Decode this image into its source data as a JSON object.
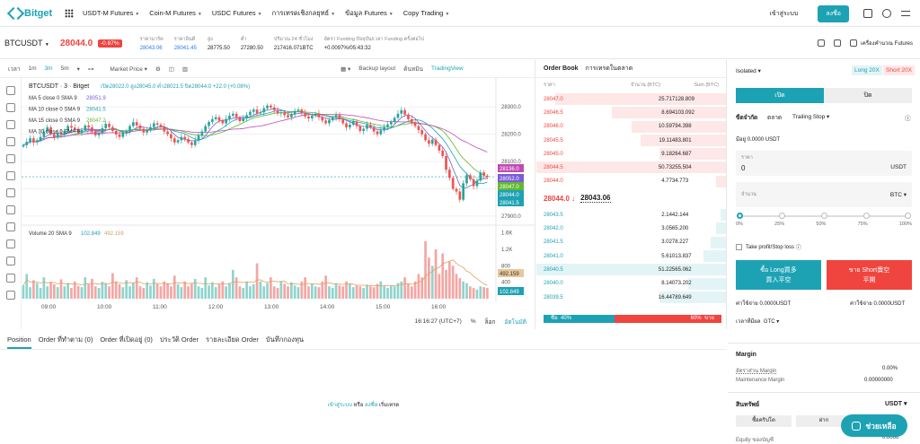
{
  "nav": {
    "logo": "Bitget",
    "items": [
      "USDT-M Futures",
      "Coin-M Futures",
      "USDC Futures",
      "การเทรดเชิงกลยุทธ์",
      "ข้อมูล Futures",
      "Copy Trading"
    ],
    "login": "เข้าสู่ระบบ",
    "signup": "ลงชื่อ"
  },
  "ticker": {
    "symbol": "BTCUSDT",
    "last_price": "28044.0",
    "change": "-0.87%",
    "stats": [
      {
        "label": "ราคามาร์ค",
        "value": "28043.06",
        "blue": true
      },
      {
        "label": "ราคาอินดี",
        "value": "28041.45",
        "blue": true
      },
      {
        "label": "สูง",
        "value": "28775.50",
        "blue": false
      },
      {
        "label": "ต่ำ",
        "value": "27280.50",
        "blue": false
      },
      {
        "label": "ปริมาณ 24 ชั่วโมง",
        "value": "217416.071BTC",
        "blue": false
      },
      {
        "label": "อัตรา Funding ปัจจุบัน/เวลา Funding ครั้งต่อไป",
        "value": "+0.0097%/05:43:32",
        "blue": false
      }
    ],
    "right_label": "เครื่องคำนวณ Futures"
  },
  "chart_toolbar": {
    "items": [
      "เวลา",
      "1m",
      "3m",
      "5m",
      "Market Price",
      "Backup layout",
      "ค้นหมิน",
      "TradingView"
    ],
    "active": "3m"
  },
  "chart_data": {
    "type": "candlestick",
    "title": "BTCUSDT · 3 · Bitget",
    "ohlc_label": "เปิด28022.0 สูง28045.0 ต่ำ28021.5 ปิด28044.0 +22.0 (+0.08%)",
    "ma_labels": [
      {
        "text": "MA 5 close 0 SMA 9",
        "value": "28051.9",
        "color": "#7b5cd6"
      },
      {
        "text": "MA 10 close 0 SMA 9",
        "value": "28041.5",
        "color": "#1da2b4"
      },
      {
        "text": "MA 15 close 0 SMA 9",
        "value": "28047.2",
        "color": "#62b82e"
      },
      {
        "text": "MA 30 close 0 SMA 9",
        "value": "28035.9",
        "color": "#c04bb4"
      }
    ],
    "y_ticks": [
      "28300.0",
      "28200.0",
      "28100.0",
      "28000.0",
      "27900.0"
    ],
    "y_range": [
      27880,
      28340
    ],
    "price_badges": [
      {
        "value": "28136.0",
        "color": "#c04bb4"
      },
      {
        "value": "28052.0",
        "color": "#7b5cd6"
      },
      {
        "value": "28047.0",
        "color": "#62b82e"
      },
      {
        "value": "28044.0",
        "color": "#1da2b4"
      },
      {
        "value": "28041.5",
        "color": "#1da2b4"
      }
    ],
    "x_ticks": [
      "09:00",
      "10:00",
      "11:00",
      "12:00",
      "13:00",
      "14:00",
      "15:00",
      "16:00"
    ],
    "close": [
      28160,
      28172,
      28185,
      28170,
      28178,
      28190,
      28210,
      28225,
      28200,
      28188,
      28205,
      28198,
      28212,
      28230,
      28224,
      28218,
      28205,
      28215,
      28232,
      28225,
      28210,
      28196,
      28205,
      28222,
      28238,
      28226,
      28212,
      28199,
      28190,
      28205,
      28210,
      28230,
      28244,
      28232,
      28220,
      28206,
      28214,
      28226,
      28240,
      28235,
      28226,
      28210,
      28200,
      28185,
      28170,
      28178,
      28190,
      28182,
      28170,
      28160,
      28178,
      28195,
      28210,
      28230,
      28245,
      28255,
      28262,
      28250,
      28240,
      28256,
      28268,
      28275,
      28262,
      28248,
      28258,
      28270,
      28282,
      28290,
      28276,
      28280,
      28295,
      28305,
      28298,
      28288,
      28276,
      28280,
      28270,
      28262,
      28272,
      28285,
      28290,
      28278,
      28265,
      28258,
      28268,
      28275,
      28262,
      28250,
      28240,
      28252,
      28262,
      28270,
      28255,
      28240,
      28225,
      28235,
      28246,
      28230,
      28212,
      28220,
      28234,
      28225,
      28210,
      28200,
      28214,
      28226,
      28236,
      28245,
      28260,
      28275,
      28288,
      28272,
      28255,
      28242,
      28230,
      28215,
      28200,
      28178,
      28165,
      28180,
      28160,
      28140,
      28120,
      28070,
      28040,
      28000,
      27990,
      27960,
      28020,
      28050,
      28035,
      28010,
      28030,
      28060,
      28048,
      28044
    ],
    "volume_label": "Volume 20 SMA 9",
    "volume_values": [
      "102.849",
      "492.159"
    ],
    "volume_ticks": [
      "1.6K",
      "1.2K",
      "800",
      "400"
    ],
    "volume": [
      320,
      600,
      280,
      450,
      380,
      260,
      520,
      300,
      410,
      350,
      280,
      470,
      300,
      380,
      260,
      420,
      310,
      280,
      520,
      350,
      480,
      300,
      260,
      410,
      380,
      300,
      620,
      420,
      350,
      280,
      450,
      300,
      380,
      520,
      300,
      260,
      400,
      320,
      480,
      360,
      300,
      420,
      380,
      300,
      560,
      350,
      280,
      420,
      300,
      360,
      480,
      300,
      260,
      520,
      320,
      400,
      280,
      350,
      420,
      300,
      380,
      700,
      520,
      300,
      260,
      420,
      300,
      350,
      860,
      420,
      300,
      380,
      520,
      300,
      260,
      420,
      360,
      300,
      400,
      320,
      280,
      420,
      520,
      300,
      360,
      300,
      280,
      420,
      560,
      300,
      260,
      380,
      320,
      300,
      420,
      360,
      280,
      320,
      300,
      260,
      340,
      300,
      280,
      360,
      420,
      300,
      260,
      320,
      300,
      380,
      420,
      520,
      360,
      300,
      420,
      600,
      520,
      1400,
      1000,
      800,
      1200,
      600,
      1100,
      700,
      900,
      800,
      600,
      500,
      420,
      380,
      300,
      260,
      220,
      300,
      280,
      260
    ],
    "time_label": "16:16:27 (UTC+7)",
    "footer": [
      "%",
      "ล็อก",
      "อัตโนมัติ"
    ]
  },
  "orderbook": {
    "tabs": [
      "Order Book",
      "การเทรดในตลาด"
    ],
    "headers": [
      "ราคา",
      "จำนวน (BTC)",
      "Sum (BTC)"
    ],
    "asks": [
      {
        "p": "28047.0",
        "a": "25.717",
        "s": "128.809",
        "w": 0.9
      },
      {
        "p": "28046.5",
        "a": "8.694",
        "s": "103.092",
        "w": 0.6
      },
      {
        "p": "28046.0",
        "a": "10.597",
        "s": "94.398",
        "w": 0.5
      },
      {
        "p": "28045.5",
        "a": "19.114",
        "s": "83.801",
        "w": 0.45
      },
      {
        "p": "28045.0",
        "a": "9.182",
        "s": "64.687",
        "w": 0.35
      },
      {
        "p": "28044.5",
        "a": "50.732",
        "s": "55.504",
        "w": 1.0
      },
      {
        "p": "28044.0",
        "a": "4.773",
        "s": "4.773",
        "w": 0.05
      }
    ],
    "mid_price": "28044.0 ↓",
    "mark_price": "28043.06",
    "bids": [
      {
        "p": "28043.5",
        "a": "2.144",
        "s": "2.144",
        "w": 0.03
      },
      {
        "p": "28042.0",
        "a": "3.056",
        "s": "5.200",
        "w": 0.05
      },
      {
        "p": "28041.5",
        "a": "3.027",
        "s": "8.227",
        "w": 0.08
      },
      {
        "p": "28041.0",
        "a": "5.610",
        "s": "13.837",
        "w": 0.12
      },
      {
        "p": "28040.5",
        "a": "51.225",
        "s": "65.062",
        "w": 1.0
      },
      {
        "p": "28040.0",
        "a": "8.140",
        "s": "73.202",
        "w": 0.2
      },
      {
        "p": "28039.5",
        "a": "16.447",
        "s": "89.649",
        "w": 0.35
      }
    ],
    "buy_label": "ซื้อ",
    "buy_pct": "40%",
    "buy_ratio": 0.4,
    "sell_pct": "60%",
    "sell_label": "ขาย"
  },
  "order_panel": {
    "margin_mode": "Isolated",
    "long_lev": "Long 20X",
    "short_lev": "Short 20X",
    "open": "เปิด",
    "close": "ปิด",
    "order_types": [
      "ขีดจำกัด",
      "ตลาด",
      "Trailing Stop"
    ],
    "available": "มีอยู่ 0.0000 USDT",
    "price_label": "ราคา",
    "price_value": "0",
    "price_unit": "USDT",
    "qty_label": "จำนวน",
    "qty_unit": "BTC",
    "slider_ticks": [
      "0%",
      "25%",
      "50%",
      "75%",
      "100%"
    ],
    "slider_level": 0,
    "tpsl": "Take profit/Stop loss",
    "long_btn": [
      "ซื้อ Long買多",
      "買入平空"
    ],
    "short_btn": [
      "ขาย Short賣空",
      "平開"
    ],
    "cost_long": "ค่าใช้จ่าย 0.0000USDT",
    "cost_short": "ค่าใช้จ่าย 0.0000USDT",
    "tif_label": "เวลาที่มีผล",
    "tif_value": "GTC",
    "margin_title": "Margin",
    "margin_ratio_label": "อัตราส่วน Margin",
    "margin_ratio": "0.00%",
    "maint_label": "Maintenance Margin",
    "maint_value": "0.00000000",
    "assets_title": "สินทรัพย์",
    "assets_unit": "USDT",
    "buy_crypto": "ซื้อคริปโต",
    "deposit": "ฝาก",
    "equity_label": "Equity ของบัญชี",
    "equity_value": "0.0000"
  },
  "positions": {
    "tabs": [
      "Position",
      "Order ที่ทำตาม (0)",
      "Order ที่เปิดอยู่ (0)",
      "ประวัติ Order",
      "รายละเอียด Order",
      "บันทึกกองทุน"
    ],
    "empty_login": "เข้าสู่ระบบ",
    "empty_or": " หรือ ",
    "empty_signup": "ลงชื่อ",
    "empty_trade": " เริ่มเทรด"
  },
  "help": "ช่วยเหลือ"
}
